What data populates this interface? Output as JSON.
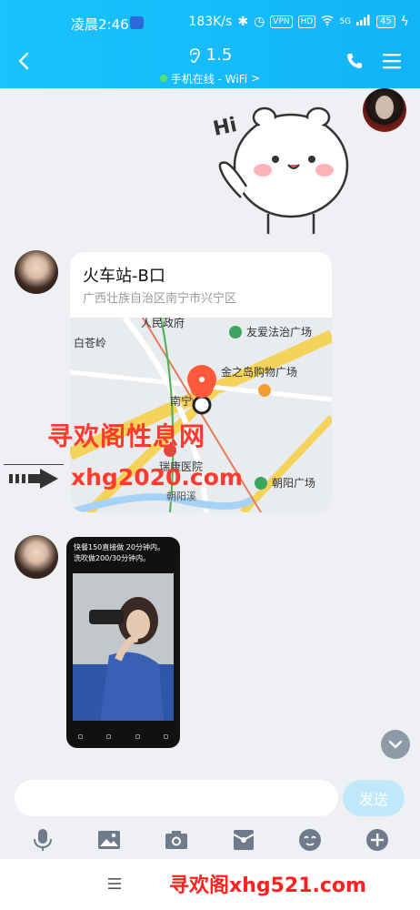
{
  "statusbar": {
    "time": "凌晨2:46",
    "speed": "183K/s",
    "vpn": "VPN",
    "hd": "HD",
    "net": "5G",
    "battery": "45"
  },
  "header": {
    "name": "1.5",
    "status": "手机在线 - WiFi",
    "status_chevron": ">"
  },
  "sticker": {
    "text": "Hi"
  },
  "location": {
    "title": "火车站-B口",
    "address": "广西壮族自治区南宁市兴宁区",
    "map_labels": [
      "人民政府",
      "友爱法治广场",
      "白苍岭",
      "金之岛购物广场",
      "南宁",
      "瑞康医院",
      "朝阳广场",
      "朝阳溪"
    ]
  },
  "image_message": {
    "caption_line1": "快餐150直接做 20分钟内。",
    "caption_line2": "洗吹做200/30分钟内。"
  },
  "watermark": {
    "cn": "寻欢阁性息网",
    "en": "xhg2020.com",
    "footer": "寻欢阁xhg521.com"
  },
  "input": {
    "value": "",
    "placeholder": "",
    "send_label": "发送"
  },
  "icons": [
    "back-icon",
    "ear-icon",
    "phone-icon",
    "menu-icon",
    "mic-icon",
    "image-icon",
    "camera-icon",
    "red-packet-icon",
    "emoji-icon",
    "plus-icon",
    "scroll-down-icon",
    "nav-menu-icon"
  ]
}
